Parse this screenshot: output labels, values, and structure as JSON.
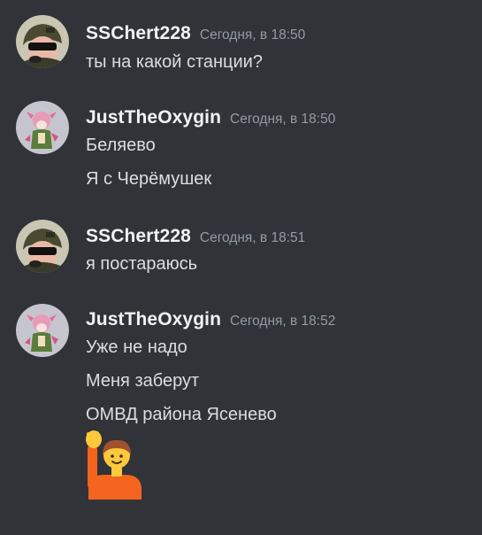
{
  "messages": [
    {
      "user": "SSChert228",
      "time": "Сегодня, в 18:50",
      "avatar_icon": "soldier-avatar-icon",
      "lines": [
        "ты на какой станции?"
      ]
    },
    {
      "user": "JustTheOxygin",
      "time": "Сегодня, в 18:50",
      "avatar_icon": "anime-girl-avatar-icon",
      "lines": [
        "Беляево",
        "Я с Черёмушек"
      ]
    },
    {
      "user": "SSChert228",
      "time": "Сегодня, в 18:51",
      "avatar_icon": "soldier-avatar-icon",
      "lines": [
        "я постараюсь"
      ]
    },
    {
      "user": "JustTheOxygin",
      "time": "Сегодня, в 18:52",
      "avatar_icon": "anime-girl-avatar-icon",
      "lines": [
        "Уже не надо",
        "Меня заберут",
        "ОМВД района Ясенево"
      ],
      "emoji": "person-raising-hand-emoji"
    }
  ],
  "colors": {
    "background": "#313338",
    "username": "#f2f3f5",
    "text": "#dbdee1",
    "timestamp": "#949ba4",
    "soldier_avatar_bg": "#c9c6b3",
    "girl_avatar_bg": "#c5c6cd",
    "emoji_skin": "#ffc83d",
    "emoji_shirt": "#f4641f"
  }
}
